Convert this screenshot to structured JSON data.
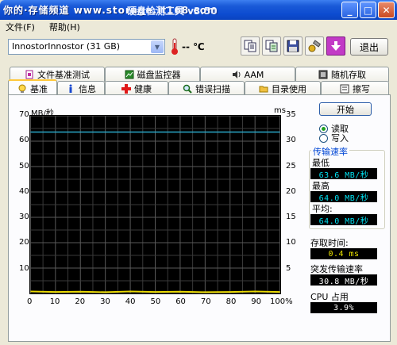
{
  "window": {
    "watermark": "你的·存储频道 www.storage.it168.com",
    "title": "硬盘检测工具 v3.50",
    "minimize": "_",
    "maximize": "□",
    "close": "✕"
  },
  "menu": [
    {
      "label": "文件(F)"
    },
    {
      "label": "帮助(H)"
    }
  ],
  "drive": {
    "selected": "InnostorInnostor (31 GB)"
  },
  "temperature": {
    "value": "--",
    "unit": "℃"
  },
  "toolbar": {
    "exit_label": "退出"
  },
  "tabs_top": [
    {
      "label": "文件基准测试",
      "icon": "file-icon"
    },
    {
      "label": "磁盘监控器",
      "icon": "monitor-icon"
    },
    {
      "label": "AAM",
      "icon": "speaker-icon"
    },
    {
      "label": "随机存取",
      "icon": "random-icon"
    }
  ],
  "tabs_bottom": [
    {
      "label": "基准",
      "icon": "bulb-icon",
      "active": true
    },
    {
      "label": "信息",
      "icon": "info-icon"
    },
    {
      "label": "健康",
      "icon": "health-cross-icon"
    },
    {
      "label": "错误扫描",
      "icon": "magnifier-icon"
    },
    {
      "label": "目录使用",
      "icon": "folder-icon"
    },
    {
      "label": "擦写",
      "icon": "erase-icon"
    }
  ],
  "chart_data": {
    "type": "line",
    "ylabel_left": "MB/秒",
    "ylabel_right": "ms",
    "ylim_left": [
      0,
      70
    ],
    "ylim_right": [
      0,
      35
    ],
    "yticks_left": [
      "70",
      "60",
      "50",
      "40",
      "30",
      "20",
      "10"
    ],
    "yticks_right": [
      "35",
      "30",
      "25",
      "20",
      "15",
      "10",
      "5"
    ],
    "xticks": [
      "0",
      "10",
      "20",
      "30",
      "40",
      "50",
      "60",
      "70",
      "80",
      "90",
      "100%"
    ],
    "grid": true,
    "series": [
      {
        "values_x": [
          0,
          100
        ],
        "values_y": [
          63.6,
          63.6
        ],
        "color": "#2aa8c8"
      },
      {
        "values_x": [
          0,
          10,
          20,
          30,
          40,
          50,
          60,
          70,
          80,
          90,
          100
        ],
        "values_y": [
          0.8,
          0.6,
          0.7,
          0.5,
          0.8,
          0.6,
          0.7,
          0.5,
          0.6,
          0.8,
          0.6
        ],
        "color": "#e8d800"
      }
    ]
  },
  "side": {
    "start_label": "开始",
    "read_label": "读取",
    "write_label": "写入",
    "rate_title": "传输速率",
    "min_label": "最低",
    "min_value": "63.6 MB/秒",
    "max_label": "最高",
    "max_value": "64.0 MB/秒",
    "avg_label": "平均:",
    "avg_value": "64.0 MB/秒",
    "access_label": "存取时间:",
    "access_value": "0.4 ms",
    "burst_label": "突发传输速率",
    "burst_value": "30.8 MB/秒",
    "cpu_label": "CPU 占用",
    "cpu_value": "3.9%"
  }
}
